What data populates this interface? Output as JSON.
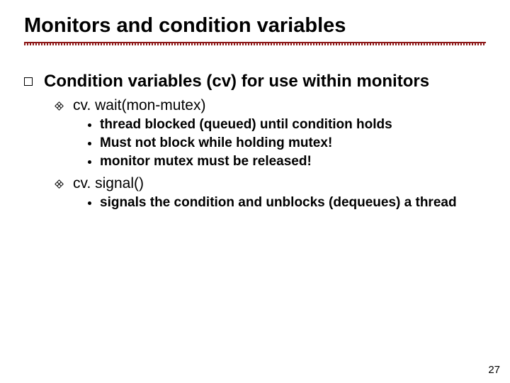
{
  "title": "Monitors and condition variables",
  "page_number": "27",
  "body": {
    "h1": "Condition variables (cv) for use within monitors",
    "items": [
      {
        "label": "cv. wait(mon-mutex)",
        "sub": [
          "thread blocked (queued) until condition holds",
          "Must not block while holding mutex!",
          "monitor mutex must be released!"
        ]
      },
      {
        "label": "cv. signal()",
        "sub": [
          "signals the condition and unblocks (dequeues) a thread"
        ]
      }
    ]
  }
}
